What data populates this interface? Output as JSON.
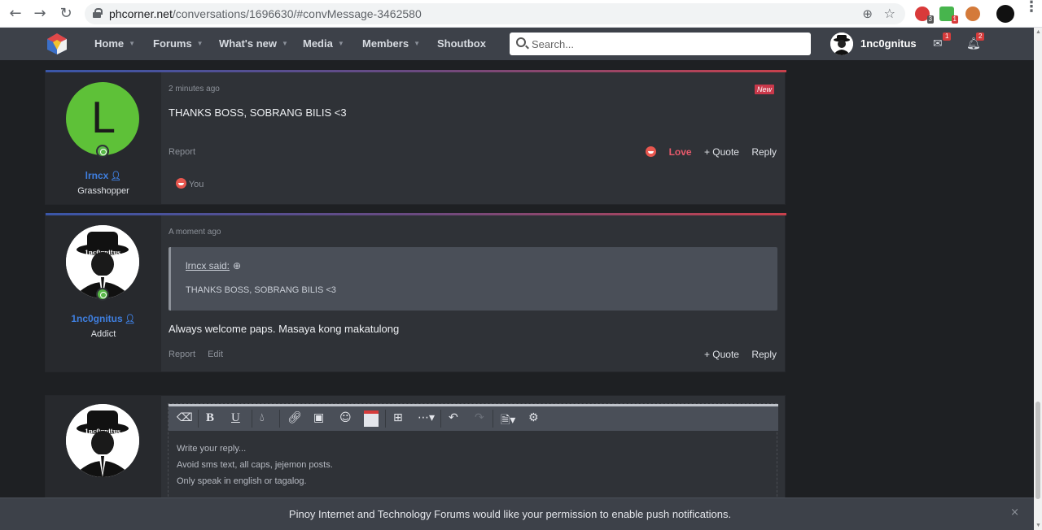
{
  "browser": {
    "url_host": "phcorner.net",
    "url_path": "/conversations/1696630/#convMessage-3462580",
    "ext_badges": [
      "3",
      "1"
    ],
    "menu_label": "⋮"
  },
  "nav": {
    "items": [
      {
        "label": "Home"
      },
      {
        "label": "Forums"
      },
      {
        "label": "What's new"
      },
      {
        "label": "Media"
      },
      {
        "label": "Members"
      },
      {
        "label": "Shoutbox"
      }
    ],
    "search_placeholder": "Search...",
    "username": "1nc0gnitus",
    "inbox_badge": "1",
    "alerts_badge": "2"
  },
  "messages": [
    {
      "avatar_letter": "L",
      "avatar_color": "#5ec138",
      "username": "lrncx",
      "rank": "Grasshopper",
      "time": "2 minutes ago",
      "badge": "New",
      "text": "THANKS BOSS, SOBRANG BILIS <3",
      "actions_left": [
        "Report"
      ],
      "love_label": "Love",
      "quote_label": "+ Quote",
      "reply_label": "Reply",
      "reaction_by": "You"
    },
    {
      "username": "1nc0gnitus",
      "rank": "Addict",
      "time": "A moment ago",
      "quote_author": "lrncx said:",
      "quote_text": "THANKS BOSS, SOBRANG BILIS <3",
      "text": "Always welcome paps. Masaya kong makatulong",
      "actions_left": [
        "Report",
        "Edit"
      ],
      "quote_label": "+ Quote",
      "reply_label": "Reply"
    }
  ],
  "editor": {
    "placeholder": "Write your reply...\nAvoid sms text, all caps, jejemon posts.\nOnly speak in english or tagalog.",
    "bold": "B",
    "underline": "U"
  },
  "notification": {
    "text": "Pinoy Internet and Technology Forums would like your permission to enable push notifications.",
    "close": "×"
  },
  "colors": {
    "accent_blue": "#3f7fe0",
    "new_badge": "#c9384a",
    "love": "#e85a6b",
    "online": "#58b947"
  }
}
